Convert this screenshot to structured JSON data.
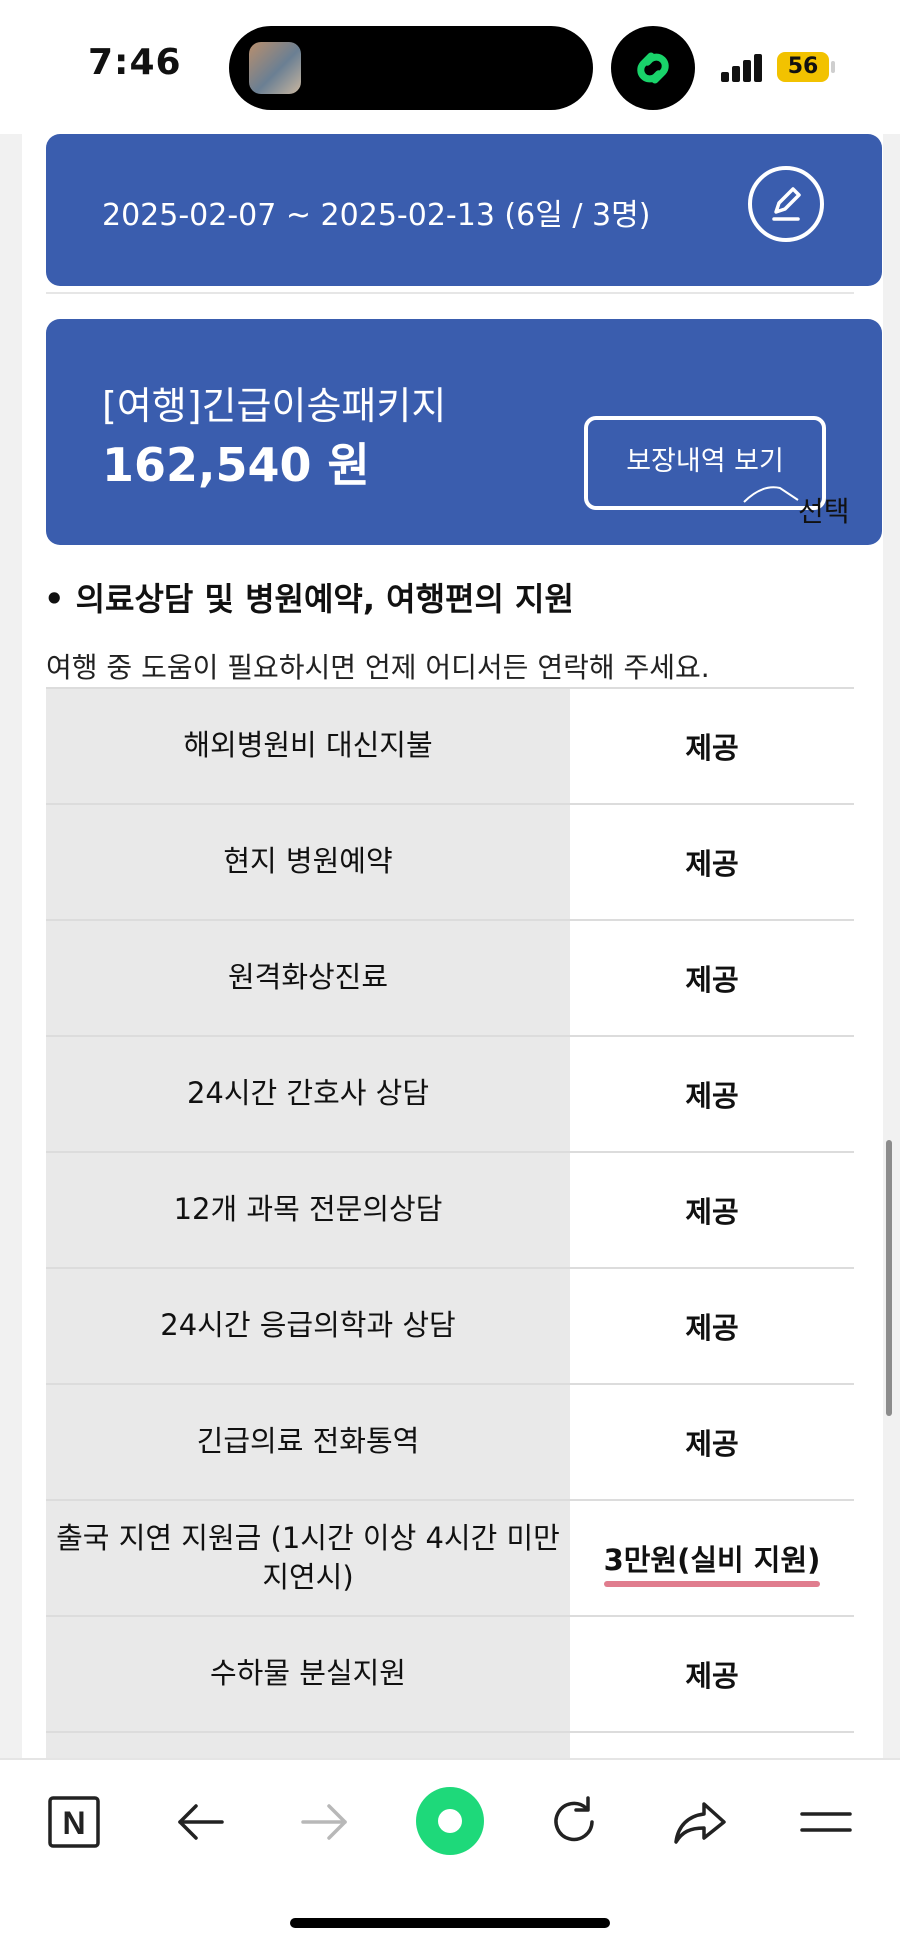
{
  "status_bar": {
    "time": "7:46",
    "battery": "56",
    "battery_color": "#f2c200",
    "link_app_color": "#19d36a"
  },
  "trip": {
    "period": "2025-02-07 ~ 2025-02-13 (6일 / 3명)",
    "edit_icon": "pencil-icon"
  },
  "package": {
    "name": "[여행]긴급이송패키지",
    "price": "162,540 원",
    "coverage_button": "보장내역 보기",
    "select_label": "선택"
  },
  "section": {
    "title": "• 의료상담 및 병원예약, 여행편의 지원",
    "description": "여행 중 도움이 필요하시면 언제 어디서든 연락해 주세요."
  },
  "table": {
    "rows": [
      {
        "label": "해외병원비 대신지불",
        "value": "제공"
      },
      {
        "label": "현지 병원예약",
        "value": "제공"
      },
      {
        "label": "원격화상진료",
        "value": "제공"
      },
      {
        "label": "24시간 간호사 상담",
        "value": "제공"
      },
      {
        "label": "12개 과목 전문의상담",
        "value": "제공"
      },
      {
        "label": "24시간 응급의학과 상담",
        "value": "제공"
      },
      {
        "label": "긴급의료 전화통역",
        "value": "제공"
      },
      {
        "label": "출국 지연 지원금 (1시간 이상 4시간 미만 지연시)",
        "value": "3만원(실비 지원)"
      },
      {
        "label": "수하물 분실지원",
        "value": "제공"
      }
    ]
  },
  "colors": {
    "card_blue": "#3a5dae",
    "highlight_underline": "#e07d8e",
    "naver_green": "#1ed97a"
  },
  "toolbar": {
    "icons": [
      "naver-n-icon",
      "back-arrow-icon",
      "forward-arrow-icon",
      "green-dot-icon",
      "reload-icon",
      "share-icon",
      "menu-icon"
    ],
    "naver_label": "N"
  }
}
